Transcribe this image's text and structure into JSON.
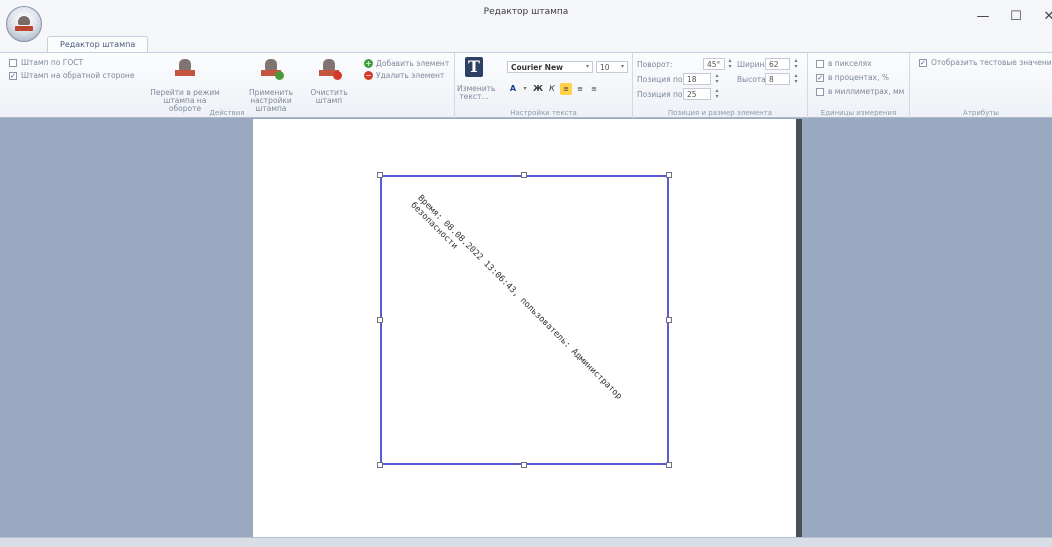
{
  "window": {
    "title": "Редактор штампа",
    "minimize_symbol": "—",
    "maximize_symbol": "☐",
    "close_symbol": "✕"
  },
  "tabs": [
    {
      "label": "Редактор штампа"
    }
  ],
  "ribbon": {
    "actions": {
      "label": "Действия",
      "gost_checkbox": {
        "label": "Штамп по ГОСТ",
        "checked": false
      },
      "back_checkbox": {
        "label": "Штамп на обратной стороне",
        "checked": true
      },
      "goto_back_button": {
        "line1": "Перейти в режим",
        "line2": "штампа на обороте"
      },
      "apply_button": {
        "line1": "Применить",
        "line2": "настройки штампа"
      },
      "clear_button": {
        "line1": "Очистить",
        "line2": "штамп"
      },
      "add_element": "Добавить элемент",
      "delete_element": "Удалить элемент"
    },
    "text_settings": {
      "label": "Настройки текста",
      "edit_text_button": {
        "line1": "Изменить",
        "line2": "текст..."
      },
      "font_name": "Courier New",
      "font_size": "10"
    },
    "position": {
      "label": "Позиция и размер элемента",
      "rotation_label": "Поворот:",
      "rotation_value": "45°",
      "width_label": "Ширина:",
      "width_value": "62",
      "pos_x_label": "Позиция по X:",
      "pos_x_value": "18",
      "height_label": "Высота:",
      "height_value": "8",
      "pos_y_label": "Позиция по Y:",
      "pos_y_value": "25"
    },
    "units": {
      "label": "Единицы измерения",
      "pixels": {
        "label": "в пикселях",
        "checked": false
      },
      "percent": {
        "label": "в процентах, %",
        "checked": true
      },
      "mm": {
        "label": "в миллиметрах, мм",
        "checked": false
      }
    },
    "attributes": {
      "label": "Атрибуты",
      "show_test": {
        "label": "Отобразить тестовые значения",
        "checked": true
      }
    }
  },
  "stamp": {
    "line1": "Время: 08.08.2022 13:06:43, пользователь: Администратор",
    "line2": "безопасности"
  },
  "colors": {
    "selection_border": "#5b5bd6",
    "workspace_bg": "#9aa9c2"
  }
}
